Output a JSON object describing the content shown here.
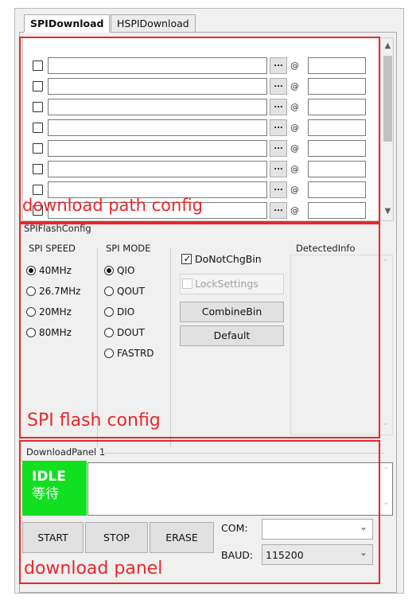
{
  "tabs": [
    {
      "label": "SPIDownload",
      "active": true
    },
    {
      "label": "HSPIDownload",
      "active": false
    }
  ],
  "download_path": {
    "rows": [
      {
        "checked": false,
        "path": "",
        "browse_label": "...",
        "at": "@",
        "address": ""
      },
      {
        "checked": false,
        "path": "",
        "browse_label": "...",
        "at": "@",
        "address": ""
      },
      {
        "checked": false,
        "path": "",
        "browse_label": "...",
        "at": "@",
        "address": ""
      },
      {
        "checked": false,
        "path": "",
        "browse_label": "...",
        "at": "@",
        "address": ""
      },
      {
        "checked": false,
        "path": "",
        "browse_label": "...",
        "at": "@",
        "address": ""
      },
      {
        "checked": false,
        "path": "",
        "browse_label": "...",
        "at": "@",
        "address": ""
      },
      {
        "checked": false,
        "path": "",
        "browse_label": "...",
        "at": "@",
        "address": ""
      },
      {
        "checked": false,
        "path": "",
        "browse_label": "...",
        "at": "@",
        "address": ""
      }
    ],
    "annotation": "download path config"
  },
  "spi_flash": {
    "title": "SPIFlashConfig",
    "speed": {
      "title": "SPI SPEED",
      "options": [
        "40MHz",
        "26.7MHz",
        "20MHz",
        "80MHz"
      ],
      "selected": "40MHz"
    },
    "mode": {
      "title": "SPI MODE",
      "options": [
        "QIO",
        "QOUT",
        "DIO",
        "DOUT",
        "FASTRD"
      ],
      "selected": "QIO"
    },
    "do_not_chg_bin": {
      "label": "DoNotChgBin",
      "checked": true
    },
    "lock_settings": {
      "label": "LockSettings",
      "checked": false,
      "disabled": true
    },
    "combine_bin_label": "CombineBin",
    "default_label": "Default",
    "detected_info": {
      "title": "DetectedInfo"
    },
    "annotation": "SPI flash config"
  },
  "download_panel": {
    "title": "DownloadPanel 1",
    "status_line1": "IDLE",
    "status_line2": "等待",
    "status_color": "#10e020",
    "start_label": "START",
    "stop_label": "STOP",
    "erase_label": "ERASE",
    "com_label": "COM:",
    "com_value": "",
    "baud_label": "BAUD:",
    "baud_value": "115200",
    "annotation": "download panel"
  },
  "colors": {
    "annotation_red": "#e8282c",
    "window_bg": "#f0f0f0"
  }
}
